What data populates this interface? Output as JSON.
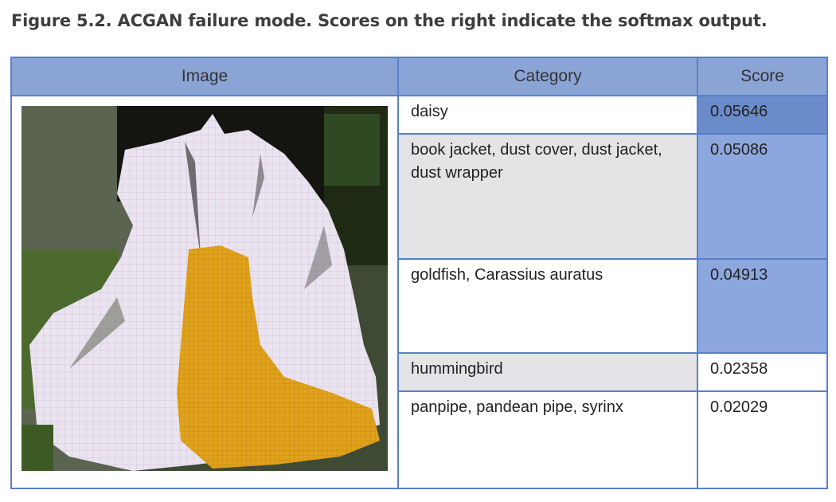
{
  "caption": "Figure 5.2. ACGAN failure mode. Scores on the right indicate the softmax output.",
  "table": {
    "headers": {
      "image": "Image",
      "category": "Category",
      "score": "Score"
    },
    "rows": [
      {
        "category": "daisy",
        "score": "0.05646"
      },
      {
        "category": "book jacket, dust cover, dust jacket, dust wrapper",
        "score": "0.05086"
      },
      {
        "category": "goldfish, Carassius auratus",
        "score": "0.04913"
      },
      {
        "category": "hummingbird",
        "score": "0.02358"
      },
      {
        "category": "panpipe, pandean pipe, syrinx",
        "score": "0.02029"
      }
    ]
  },
  "colors": {
    "border": "#5b7fc8",
    "header": "#8aa4d6",
    "score_highlight": "#8ca7dd",
    "score_top": "#6b8ccb",
    "row_gray": "#e4e4e6"
  },
  "image": {
    "subject": "generated-daisy-flower-image"
  }
}
